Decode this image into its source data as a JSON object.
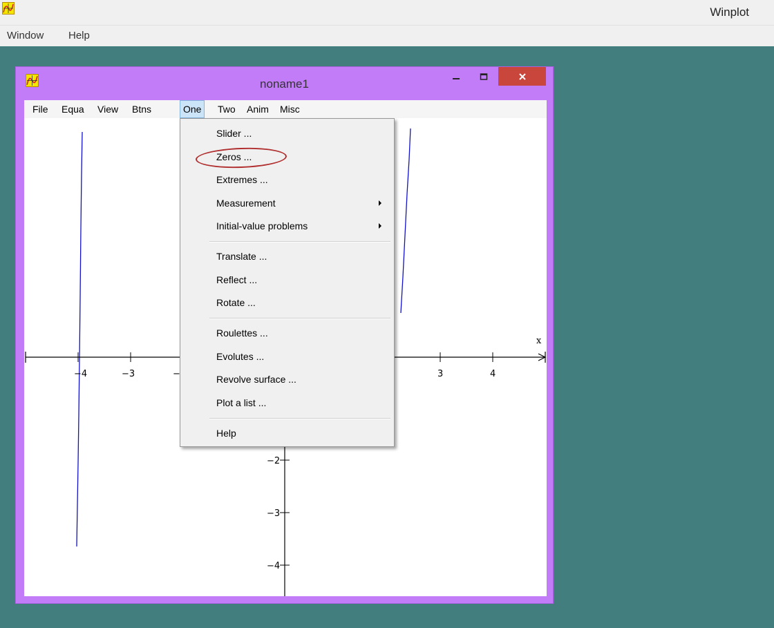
{
  "app": {
    "title": "Winplot",
    "menu": [
      "Window",
      "Help"
    ]
  },
  "window": {
    "title": "noname1",
    "menu": [
      "File",
      "Equa",
      "View",
      "Btns",
      "One",
      "Two",
      "Anim",
      "Misc"
    ],
    "active_menu": "One"
  },
  "dropdown": {
    "items": [
      {
        "label": "Slider ...",
        "submenu": false
      },
      {
        "label": "Zeros ...",
        "submenu": false,
        "highlighted": true
      },
      {
        "label": "Extremes ...",
        "submenu": false
      },
      {
        "label": "Measurement",
        "submenu": true
      },
      {
        "label": "Initial-value problems",
        "submenu": true
      },
      {
        "label": "Translate ...",
        "submenu": false
      },
      {
        "label": "Reflect ...",
        "submenu": false
      },
      {
        "label": "Rotate ...",
        "submenu": false
      },
      {
        "label": "Roulettes ...",
        "submenu": false
      },
      {
        "label": "Evolutes ...",
        "submenu": false
      },
      {
        "label": "Revolve surface ...",
        "submenu": false
      },
      {
        "label": "Plot a list ...",
        "submenu": false
      },
      {
        "label": "Help",
        "submenu": false
      }
    ]
  },
  "plot": {
    "x_axis_label": "x",
    "x_ticks": [
      "−4",
      "−3",
      "−",
      "3",
      "4"
    ],
    "y_ticks": [
      "−2",
      "−3",
      "−4"
    ]
  },
  "colors": {
    "desktop": "#427e7d",
    "window_frame": "#c37cf7",
    "close_button": "#c9463d",
    "curve": "#1010c8",
    "highlight_ring": "#b02e2e"
  },
  "icons": {
    "app_icon": "winplot-icon",
    "child_icon": "winplot-icon",
    "submenu_arrow": "chevron-right-icon"
  }
}
